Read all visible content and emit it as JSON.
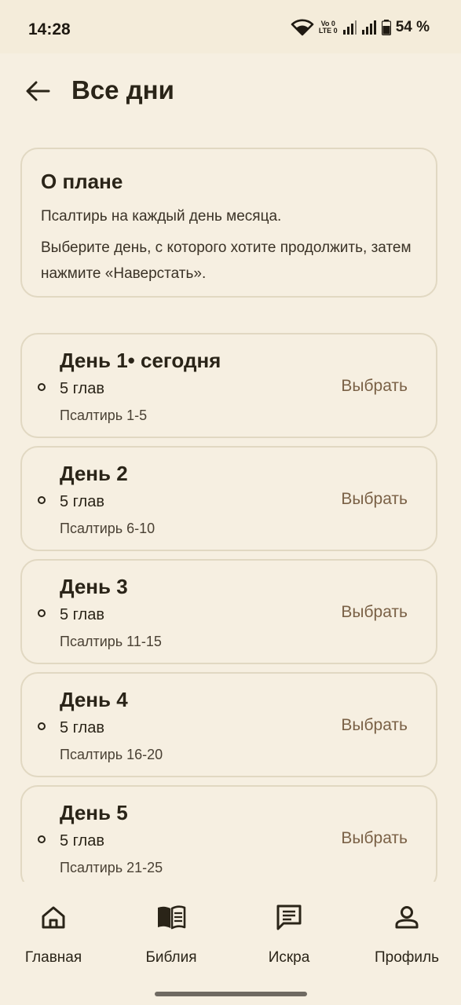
{
  "status_bar": {
    "time": "14:28",
    "volte_top": "Vo 0",
    "volte_bottom": "LTE 0",
    "battery_percent": "54 %",
    "icons": [
      "wifi-icon",
      "volte-icon",
      "signal-icon",
      "signal-icon",
      "battery-icon"
    ]
  },
  "header": {
    "title": "Все дни",
    "back_icon": "arrow-left-icon"
  },
  "about": {
    "title": "О плане",
    "line1": "Псалтирь на каждый день месяца.",
    "line2": "Выберите день, с которого хотите продолжить, затем нажмите «Наверстать»."
  },
  "days": [
    {
      "title": "День 1• сегодня",
      "chapters": "5 глав",
      "reference": "Псалтирь 1-5",
      "action": "Выбрать"
    },
    {
      "title": "День 2",
      "chapters": "5 глав",
      "reference": "Псалтирь 6-10",
      "action": "Выбрать"
    },
    {
      "title": "День 3",
      "chapters": "5 глав",
      "reference": "Псалтирь 11-15",
      "action": "Выбрать"
    },
    {
      "title": "День 4",
      "chapters": "5 глав",
      "reference": "Псалтирь 16-20",
      "action": "Выбрать"
    },
    {
      "title": "День 5",
      "chapters": "5 глав",
      "reference": "Псалтирь 21-25",
      "action": "Выбрать"
    }
  ],
  "nav": {
    "items": [
      {
        "label": "Главная",
        "icon": "home-icon"
      },
      {
        "label": "Библия",
        "icon": "book-icon"
      },
      {
        "label": "Искра",
        "icon": "message-icon"
      },
      {
        "label": "Профиль",
        "icon": "profile-icon"
      }
    ]
  },
  "colors": {
    "background": "#f6efe1",
    "text": "#2a2418",
    "accent": "#7a6146",
    "card_border": "#e1d8c2"
  }
}
